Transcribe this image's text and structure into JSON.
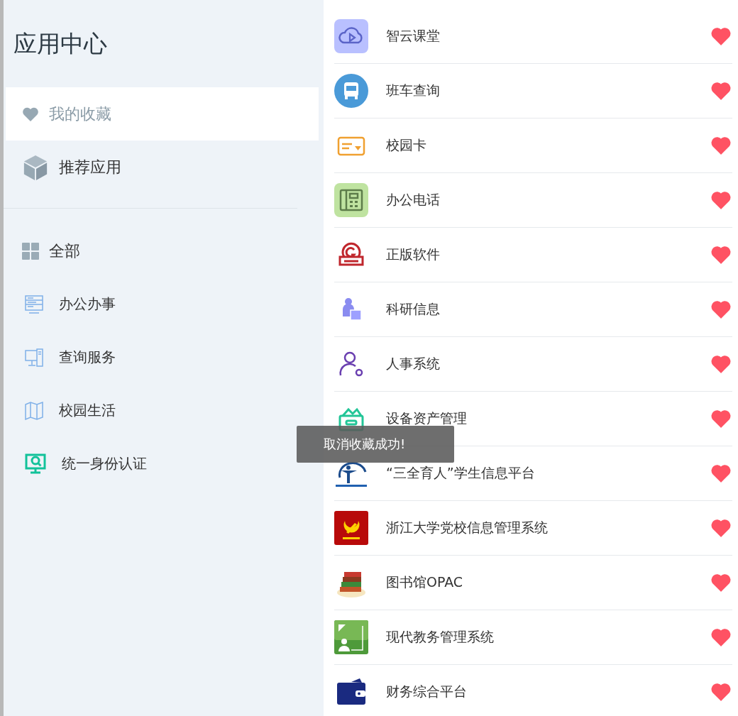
{
  "sidebar": {
    "title": "应用中心",
    "sections": [
      {
        "label": "我的收藏",
        "selected": true
      },
      {
        "label": "推荐应用",
        "selected": false
      }
    ],
    "categories": [
      {
        "label": "全部",
        "kind": "all"
      },
      {
        "label": "办公办事",
        "kind": "category"
      },
      {
        "label": "查询服务",
        "kind": "category"
      },
      {
        "label": "校园生活",
        "kind": "category"
      },
      {
        "label": "统一身份认证",
        "kind": "category"
      }
    ]
  },
  "apps": [
    {
      "name": "智云课堂",
      "favorited": true
    },
    {
      "name": "班车查询",
      "favorited": true
    },
    {
      "name": "校园卡",
      "favorited": true
    },
    {
      "name": "办公电话",
      "favorited": true
    },
    {
      "name": "正版软件",
      "favorited": true
    },
    {
      "name": "科研信息",
      "favorited": true
    },
    {
      "name": "人事系统",
      "favorited": true
    },
    {
      "name": "设备资产管理",
      "favorited": true
    },
    {
      "name": "“三全育人”学生信息平台",
      "favorited": true
    },
    {
      "name": "浙江大学党校信息管理系统",
      "favorited": true
    },
    {
      "name": "图书馆OPAC",
      "favorited": true
    },
    {
      "name": "现代教务管理系统",
      "favorited": true
    },
    {
      "name": "财务综合平台",
      "favorited": true
    }
  ],
  "toast": {
    "message": "取消收藏成功!"
  }
}
